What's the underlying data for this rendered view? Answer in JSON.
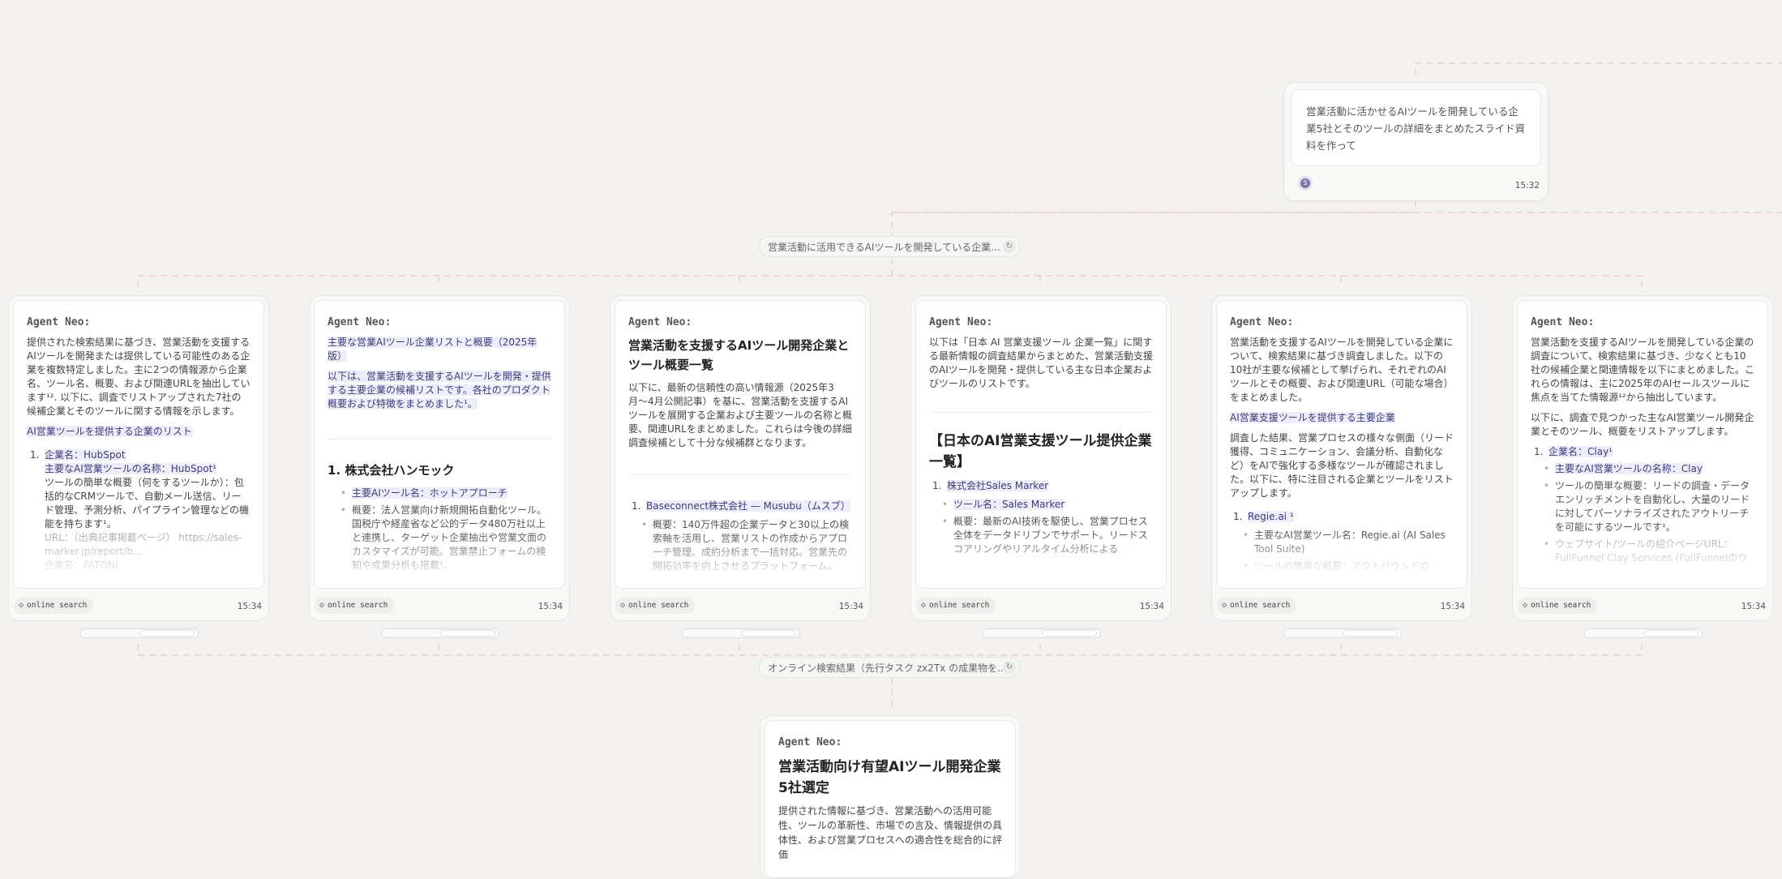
{
  "user_message": {
    "text": "営業活動に活かせるAIツールを開発している企業5社とそのツールの詳細をまとめたスライド資料を作って",
    "avatar": "S",
    "time": "15:32"
  },
  "task_pill_1": {
    "text": "営業活動に活用できるAIツールを開発している企業...",
    "icon": "refresh-icon"
  },
  "task_pill_2": {
    "text": "オンライン検索結果（先行タスク zx2Tx の成果物を...",
    "icon": "refresh-icon"
  },
  "common": {
    "agent": "Agent Neo:",
    "chip": "online search",
    "time": "15:34"
  },
  "cards": [
    {
      "p1": "提供された検索結果に基づき、営業活動を支援するAIツールを開発または提供している可能性のある企業を複数特定しました。主に2つの情報源から企業名、ツール名、概要、および関連URLを抽出しています¹². 以下に、調査でリストアップされた7社の候補企業とそのツールに関する情報を示します。",
      "heading": "AI営業ツールを提供する企業のリスト",
      "l1": "企業名：HubSpot",
      "l2": "主要なAI営業ツールの名称：HubSpot¹",
      "l3": "ツールの簡単な概要（何をするツールか）：包括的なCRMツールで、自動メール送信、リード管理、予測分析、パイプライン管理などの機能を持ちます¹。",
      "l4": "URL：（出典記事掲載ページ） https://sales-marker.jp/report/b...",
      "l5": "企業名：FATONI"
    },
    {
      "hl": "主要な営業AIツール企業リストと概要（2025年版）",
      "p1": "以下は、営業活動を支援するAIツールを開発・提供する主要企業の候補リストです。各社のプロダクト概要および特徴をまとめました¹。",
      "h": "1. 株式会社ハンモック",
      "s1": "主要AIツール名：ホットアプローチ",
      "s2": "概要：法人営業向け新規開拓自動化ツール。国税庁や経産省など公的データ480万社以上と連携し、ターゲット企業抽出や営業文面のカスタマイズが可能。営業禁止フォームの検知や成果分析も搭載¹。"
    },
    {
      "h": "営業活動を支援するAIツール開発企業とツール概要一覧",
      "p1": "以下に、最新の信頼性の高い情報源（2025年3月〜4月公開記事）を基に、営業活動を支援するAIツールを展開する企業および主要ツールの名称と概要、関連URLをまとめました。これらは今後の詳細調査候補として十分な候補群となります。",
      "l1": "Baseconnect株式会社 — Musubu（ムスブ）",
      "s1": "概要：140万件超の企業データと30以上の検索軸を活用し、営業リストの作成からアプローチ管理、成約分析まで一括対応。営業先の開拓効率を向上させるプラットフォーム。"
    },
    {
      "p1": "以下は「日本 AI 営業支援ツール 企業一覧」に関する最新情報の調査結果からまとめた、営業活動支援のAIツールを開発・提供している主な日本企業およびツールのリストです。",
      "h": "【日本のAI営業支援ツール提供企業一覧】",
      "l1": "株式会社Sales Marker",
      "s1": "ツール名：Sales Marker",
      "s2": "概要：最新のAI技術を駆使し、営業プロセス全体をデータドリブンでサポート。リードスコアリングやリアルタイム分析による"
    },
    {
      "p1": "営業活動を支援するAIツールを開発している企業について、検索結果に基づき調査しました。以下の10社が主要な候補として挙げられ、それぞれのAIツールとその概要、および関連URL（可能な場合）をまとめました。",
      "heading": "AI営業支援ツールを提供する主要企業",
      "p2": "調査した結果、営業プロセスの様々な側面（リード獲得、コミュニケーション、会議分析、自動化など）をAIで強化する多様なツールが確認されました。以下に、特に注目される企業とツールをリストアップします。",
      "l1": "Regie.ai ¹",
      "s1": "主要なAI営業ツール名：Regie.ai (AI Sales Tool Suite)",
      "s2": "ツールの簡単な概要：アウトバウンドの"
    },
    {
      "p1": "営業活動を支援するAIツールを開発している企業の調査について、検索結果に基づき、少なくとも10社の候補企業と関連情報を以下にまとめました。これらの情報は、主に2025年のAIセールスツールに焦点を当てた情報源¹²から抽出しています。",
      "p2": "以下に、調査で見つかった主なAI営業ツール開発企業とそのツール、概要をリストアップします。",
      "l1": "企業名：Clay¹",
      "s1": "主要なAI営業ツールの名称：Clay",
      "s2": "ツールの簡単な概要：リードの調査・データエンリッチメントを自動化し、大量のリードに対してパーソナライズされたアウトリーチを可能にするツールです¹。",
      "s3": "ウェブサイト/ツールの紹介ページURL：FullFunnel Clay Services (FullFunnelのウ"
    }
  ],
  "bottom": {
    "h": "営業活動向け有望AIツール開発企業 5社選定",
    "p1": "提供された情報に基づき、営業活動への活用可能性、ツールの革新性、市場での言及、情報提供の具体性、および営業プロセスへの適合性を総合的に評価"
  }
}
